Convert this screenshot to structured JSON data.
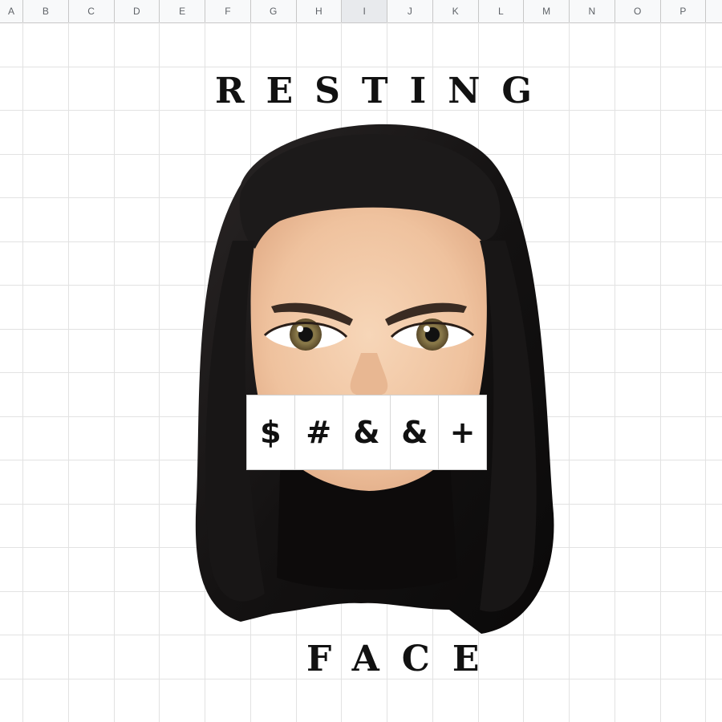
{
  "spreadsheet": {
    "columns": [
      "A",
      "B",
      "C",
      "D",
      "E",
      "F",
      "G",
      "H",
      "I",
      "J",
      "K",
      "L",
      "M",
      "N",
      "O",
      "P"
    ],
    "selected_column": "I"
  },
  "title": {
    "top": "RESTING",
    "bottom": "FACE"
  },
  "censor": {
    "symbols": [
      "$",
      "#",
      "&",
      "&",
      "+"
    ]
  },
  "colors": {
    "hair": "#141212",
    "skin": "#f2c9a7",
    "grid": "#e2e2e2",
    "header_bg": "#f8f9fa",
    "text": "#111111"
  }
}
